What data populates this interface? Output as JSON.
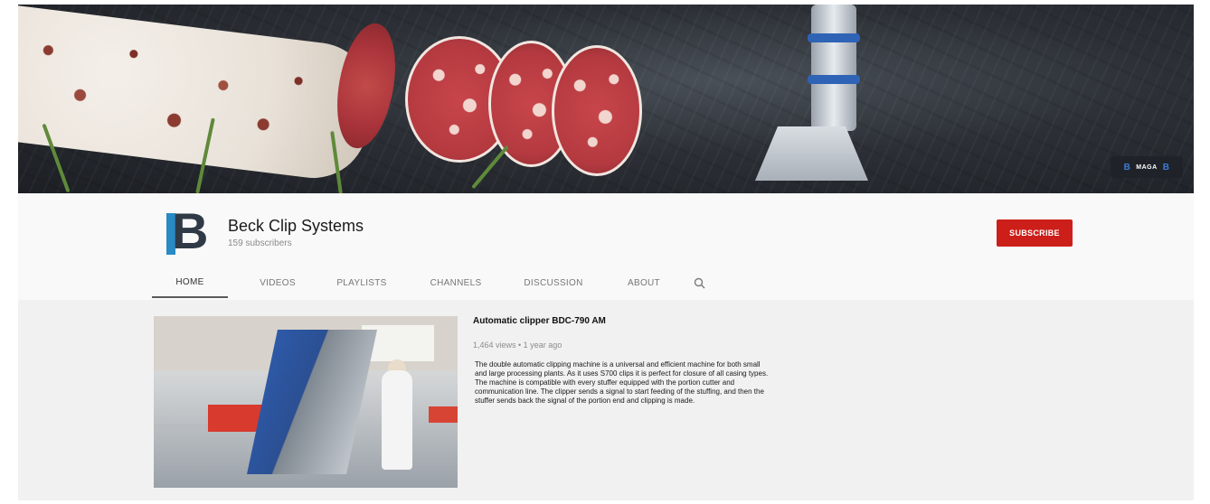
{
  "banner": {
    "badge_text": "MAGA"
  },
  "channel": {
    "name": "Beck Clip Systems",
    "subscribers": "159 subscribers",
    "subscribe_label": "SUBSCRIBE",
    "brand_color": "#2a8ac4",
    "subscribe_color": "#cc1f1a"
  },
  "tabs": [
    {
      "label": "HOME",
      "active": true
    },
    {
      "label": "VIDEOS",
      "active": false
    },
    {
      "label": "PLAYLISTS",
      "active": false
    },
    {
      "label": "CHANNELS",
      "active": false
    },
    {
      "label": "DISCUSSION",
      "active": false
    },
    {
      "label": "ABOUT",
      "active": false
    }
  ],
  "search_icon": "search-icon",
  "featured_video": {
    "title": "Automatic clipper BDC-790 AM",
    "meta": "1,464 views • 1 year ago",
    "description": "The double automatic clipping machine is a universal and efficient machine for both small and large processing plants. As it uses S700 clips it is perfect for closure of all casing types. The machine is compatible with every stuffer equipped with the portion cutter and communication line. The clipper sends a signal to start feeding of the stuffing, and then the stuffer sends back the signal of the portion end and clipping is made."
  }
}
